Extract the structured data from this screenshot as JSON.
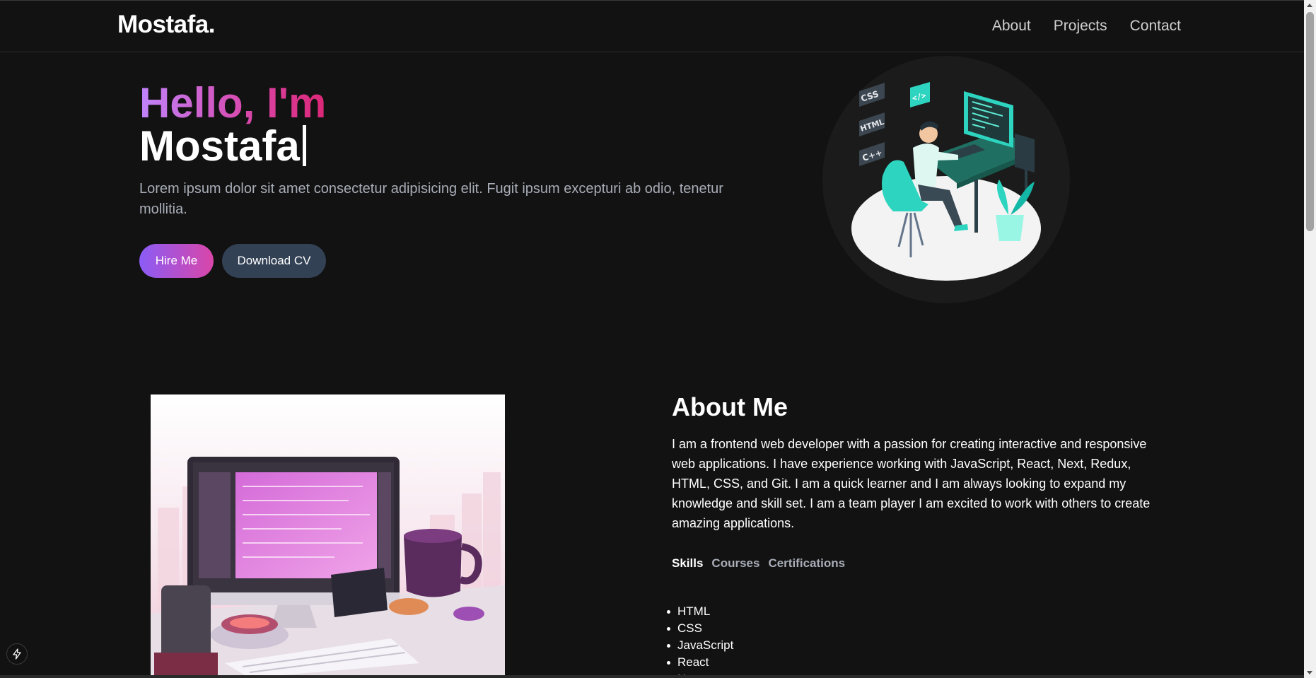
{
  "nav": {
    "logo": "Mostafa.",
    "links": [
      "About",
      "Projects",
      "Contact"
    ]
  },
  "hero": {
    "greeting": "Hello, I'm",
    "name": "Mostafa",
    "description": "Lorem ipsum dolor sit amet consectetur adipisicing elit. Fugit ipsum excepturi ab odio, tenetur mollitia.",
    "hire_label": "Hire Me",
    "cv_label": "Download CV",
    "illustration_tags": [
      "CSS",
      "HTML",
      "C++",
      "</>"
    ]
  },
  "about": {
    "title": "About Me",
    "text": "I am a frontend web developer with a passion for creating interactive and responsive web applications. I have experience working with JavaScript, React, Next, Redux, HTML, CSS, and Git. I am a quick learner and I am always looking to expand my knowledge and skill set. I am a team player I am excited to work with others to create amazing applications.",
    "tabs": [
      "Skills",
      "Courses",
      "Certifications"
    ],
    "active_tab": "Skills",
    "skills": [
      "HTML",
      "CSS",
      "JavaScript",
      "React",
      "Next"
    ]
  },
  "colors": {
    "background": "#121212",
    "gradient_start": "#c084fc",
    "gradient_end": "#db2777",
    "button_secondary": "#334155",
    "accent_teal": "#2dd4bf"
  },
  "icons": {
    "devtools": "lightning-bolt-icon"
  }
}
